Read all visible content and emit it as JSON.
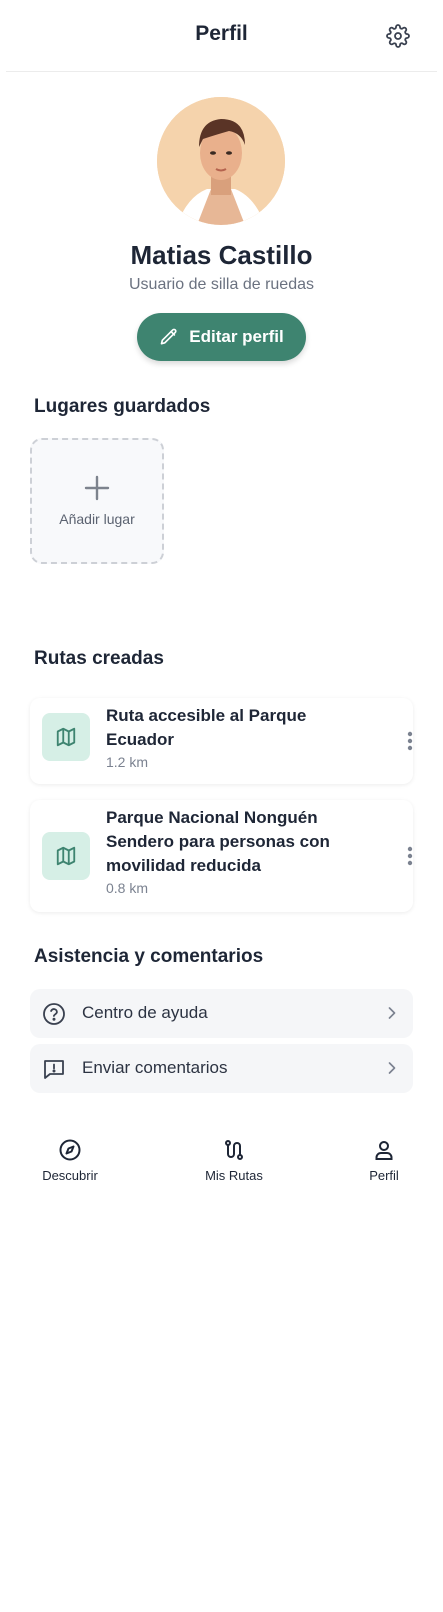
{
  "header": {
    "title": "Perfil",
    "settings_icon": "gear-icon"
  },
  "profile": {
    "name": "Matias Castillo",
    "subtitle": "Usuario de silla de ruedas",
    "edit_label": "Editar perfil",
    "accent": "#3e8470"
  },
  "saved_places": {
    "title": "Lugares guardados",
    "add_label": "Añadir lugar"
  },
  "routes": {
    "title": "Rutas creadas",
    "items": [
      {
        "name_line1": "Ruta accesible al Parque",
        "name_line2": "Ecuador",
        "name_line3": "",
        "distance": "1.2 km"
      },
      {
        "name_line1": "Parque Nacional Nonguén",
        "name_line2": "Sendero para personas con",
        "name_line3": "movilidad reducida",
        "distance": "0.8 km"
      }
    ]
  },
  "support": {
    "title": "Asistencia y comentarios",
    "items": [
      {
        "label": "Centro de ayuda",
        "icon": "help-circle-icon"
      },
      {
        "label": "Enviar comentarios",
        "icon": "feedback-icon"
      }
    ]
  },
  "bottom_nav": {
    "items": [
      {
        "label": "Descubrir",
        "icon": "compass-icon"
      },
      {
        "label": "Mis Rutas",
        "icon": "route-icon"
      },
      {
        "label": "Perfil",
        "icon": "user-icon"
      }
    ]
  }
}
